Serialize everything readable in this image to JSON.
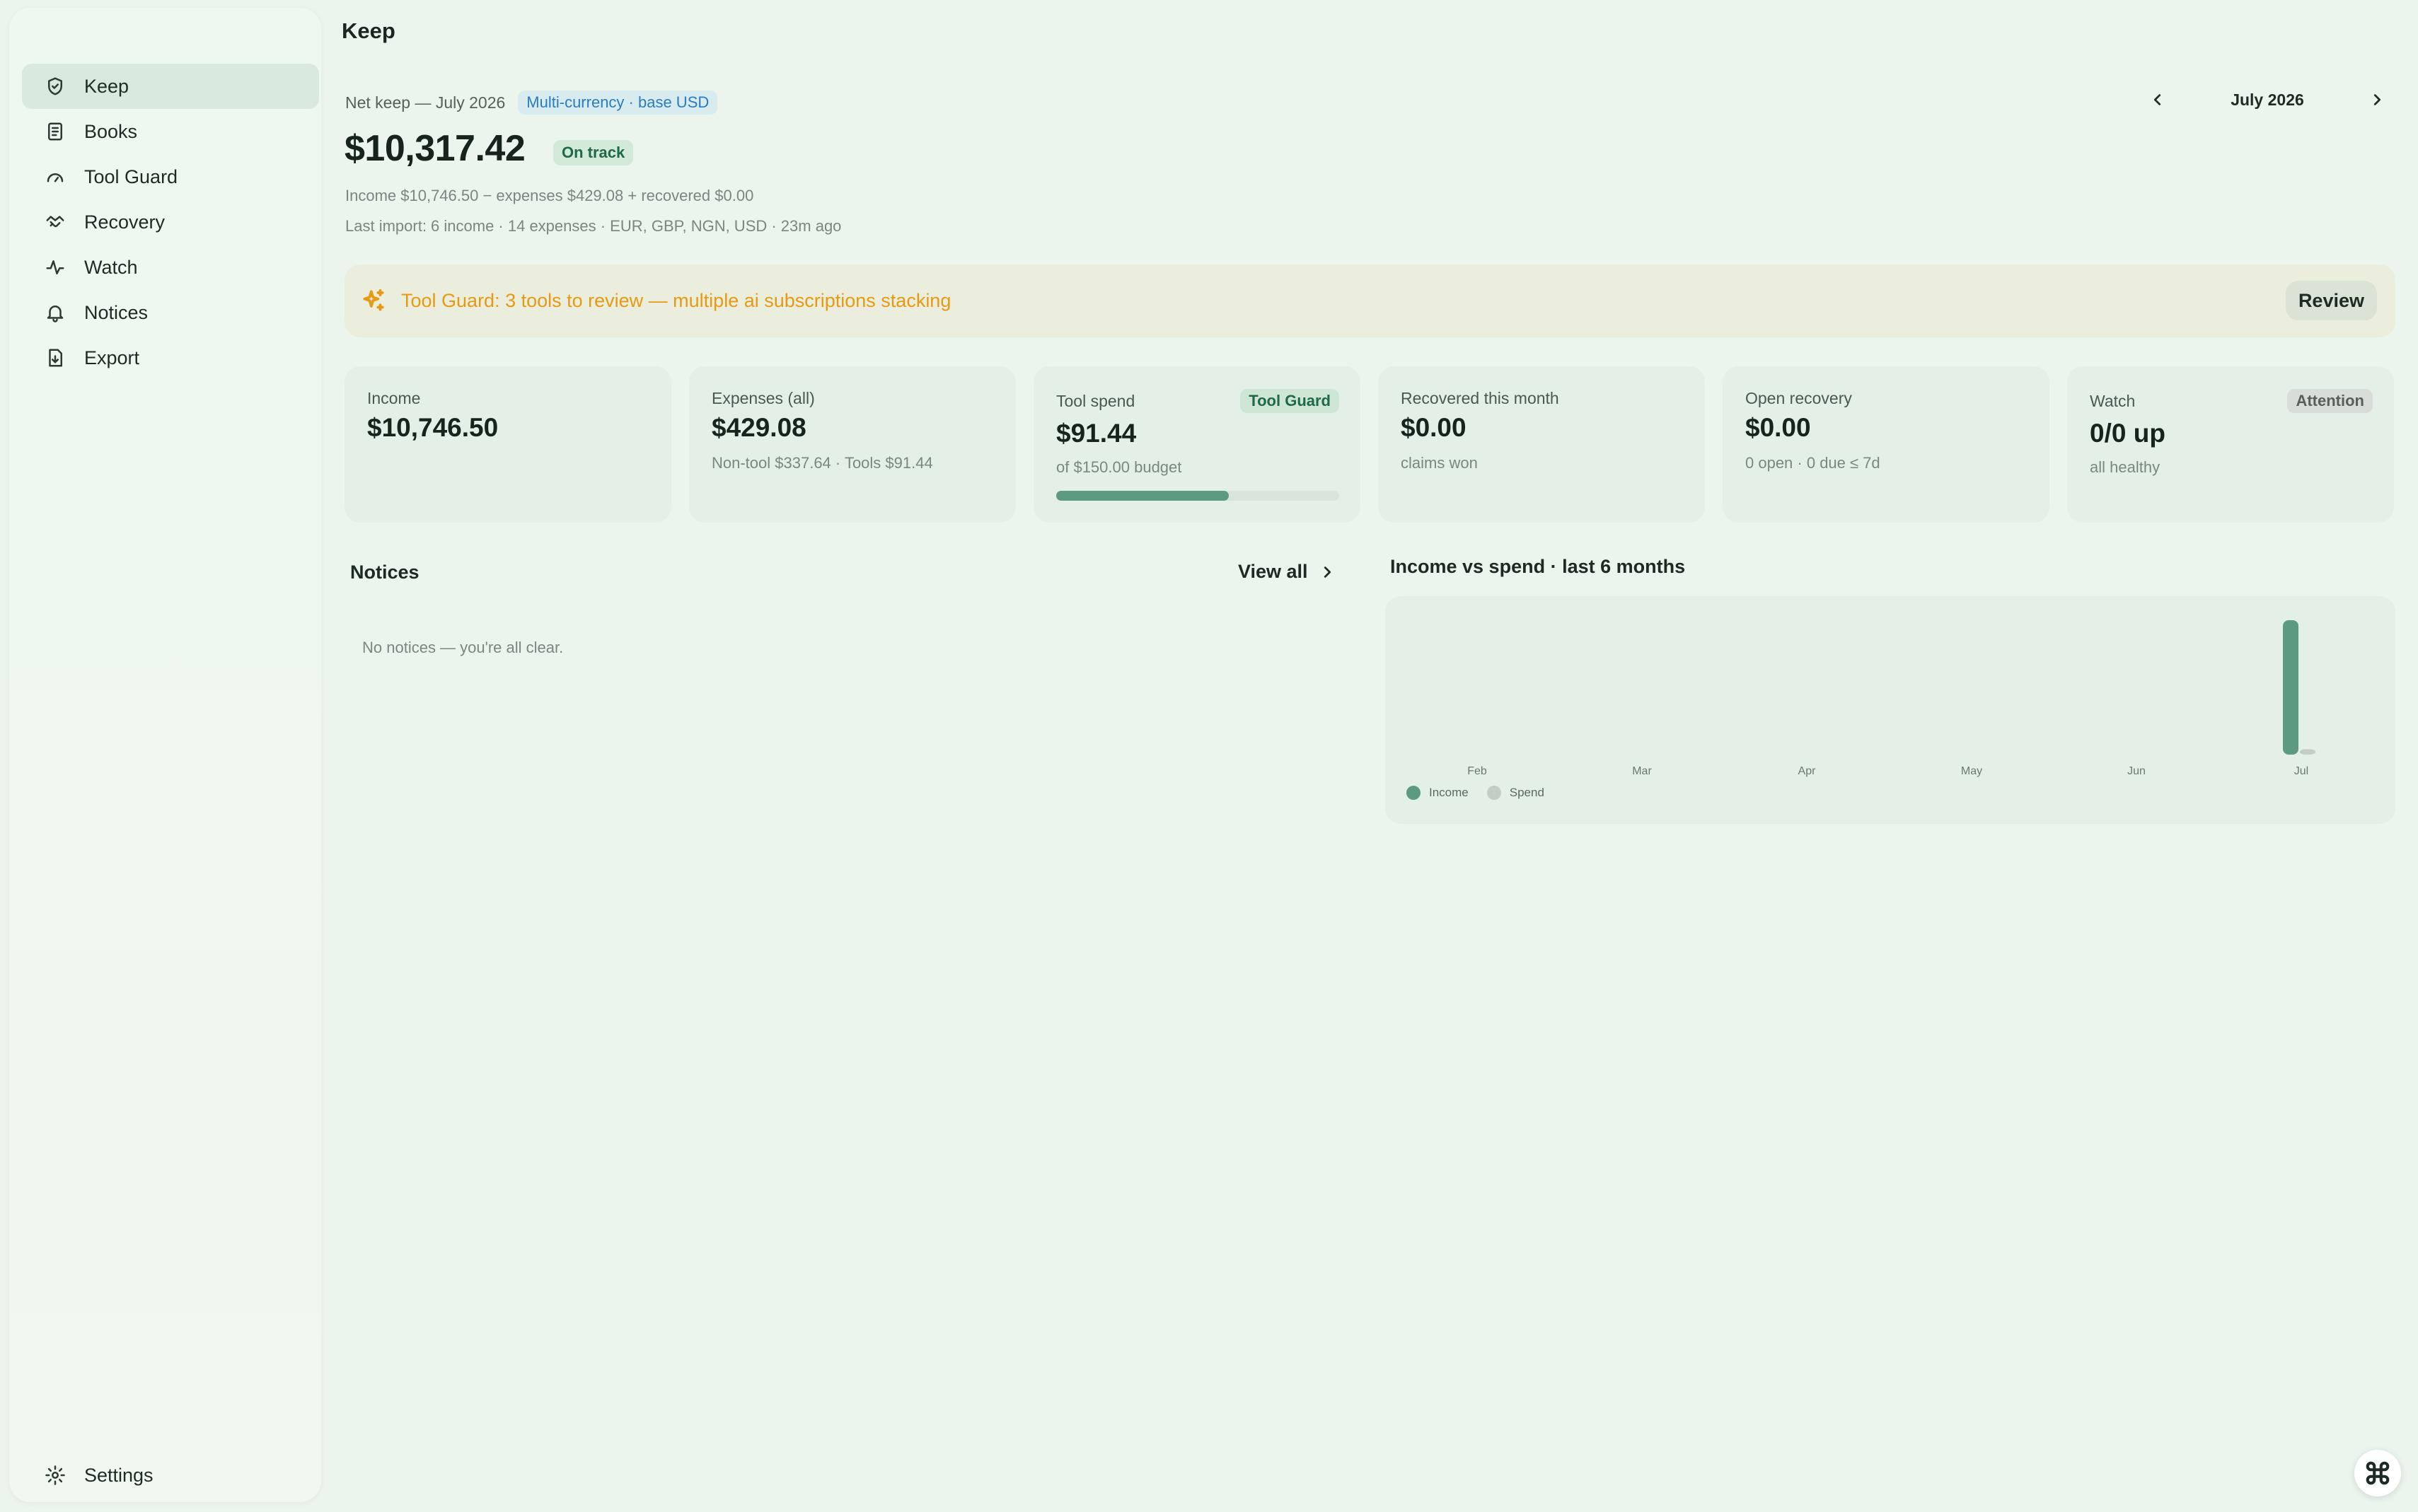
{
  "app": {
    "page_title": "Keep"
  },
  "sidebar": {
    "items": [
      {
        "label": "Keep",
        "icon": "shield-check-icon",
        "active": true
      },
      {
        "label": "Books",
        "icon": "book-icon",
        "active": false
      },
      {
        "label": "Tool Guard",
        "icon": "gauge-icon",
        "active": false
      },
      {
        "label": "Recovery",
        "icon": "handshake-icon",
        "active": false
      },
      {
        "label": "Watch",
        "icon": "activity-icon",
        "active": false
      },
      {
        "label": "Notices",
        "icon": "bell-icon",
        "active": false
      },
      {
        "label": "Export",
        "icon": "file-export-icon",
        "active": false
      }
    ],
    "settings_label": "Settings"
  },
  "header": {
    "net_keep_label": "Net keep — July 2026",
    "currency_badge": "Multi-currency · base USD",
    "month": "July 2026",
    "amount": "$10,317.42",
    "status_badge": "On track",
    "breakdown": "Income $10,746.50 − expenses $429.08 + recovered $0.00",
    "last_import": "Last import: 6 income · 14 expenses · EUR, GBP, NGN, USD · 23m ago"
  },
  "alert": {
    "text": "Tool Guard: 3 tools to review — multiple ai subscriptions stacking",
    "button": "Review",
    "color": "#e69a14"
  },
  "cards": [
    {
      "label": "Income",
      "value": "$10,746.50",
      "sub": ""
    },
    {
      "label": "Expenses (all)",
      "value": "$429.08",
      "sub": "Non-tool $337.64 · Tools $91.44"
    },
    {
      "label": "Tool spend",
      "value": "$91.44",
      "sub": "of $150.00 budget",
      "badge": "Tool Guard",
      "progress": 0.61
    },
    {
      "label": "Recovered this month",
      "value": "$0.00",
      "sub": "claims won"
    },
    {
      "label": "Open recovery",
      "value": "$0.00",
      "sub": "0 open · 0 due ≤ 7d"
    },
    {
      "label": "Watch",
      "value": "0/0 up",
      "sub": "all healthy",
      "badge": "Attention"
    }
  ],
  "notices": {
    "title": "Notices",
    "view_all": "View all",
    "empty": "No notices — you're all clear."
  },
  "chart_data": {
    "type": "bar",
    "title": "Income vs spend · last 6 months",
    "categories": [
      "Feb",
      "Mar",
      "Apr",
      "May",
      "Jun",
      "Jul"
    ],
    "series": [
      {
        "name": "Income",
        "values": [
          0,
          0,
          0,
          0,
          0,
          10746.5
        ],
        "color": "#5d9a82"
      },
      {
        "name": "Spend",
        "values": [
          0,
          0,
          0,
          0,
          0,
          429.08
        ],
        "color": "#c3cdc6"
      }
    ],
    "ylim": [
      0,
      10746.5
    ],
    "grid": false,
    "legend": "bottom-left"
  }
}
